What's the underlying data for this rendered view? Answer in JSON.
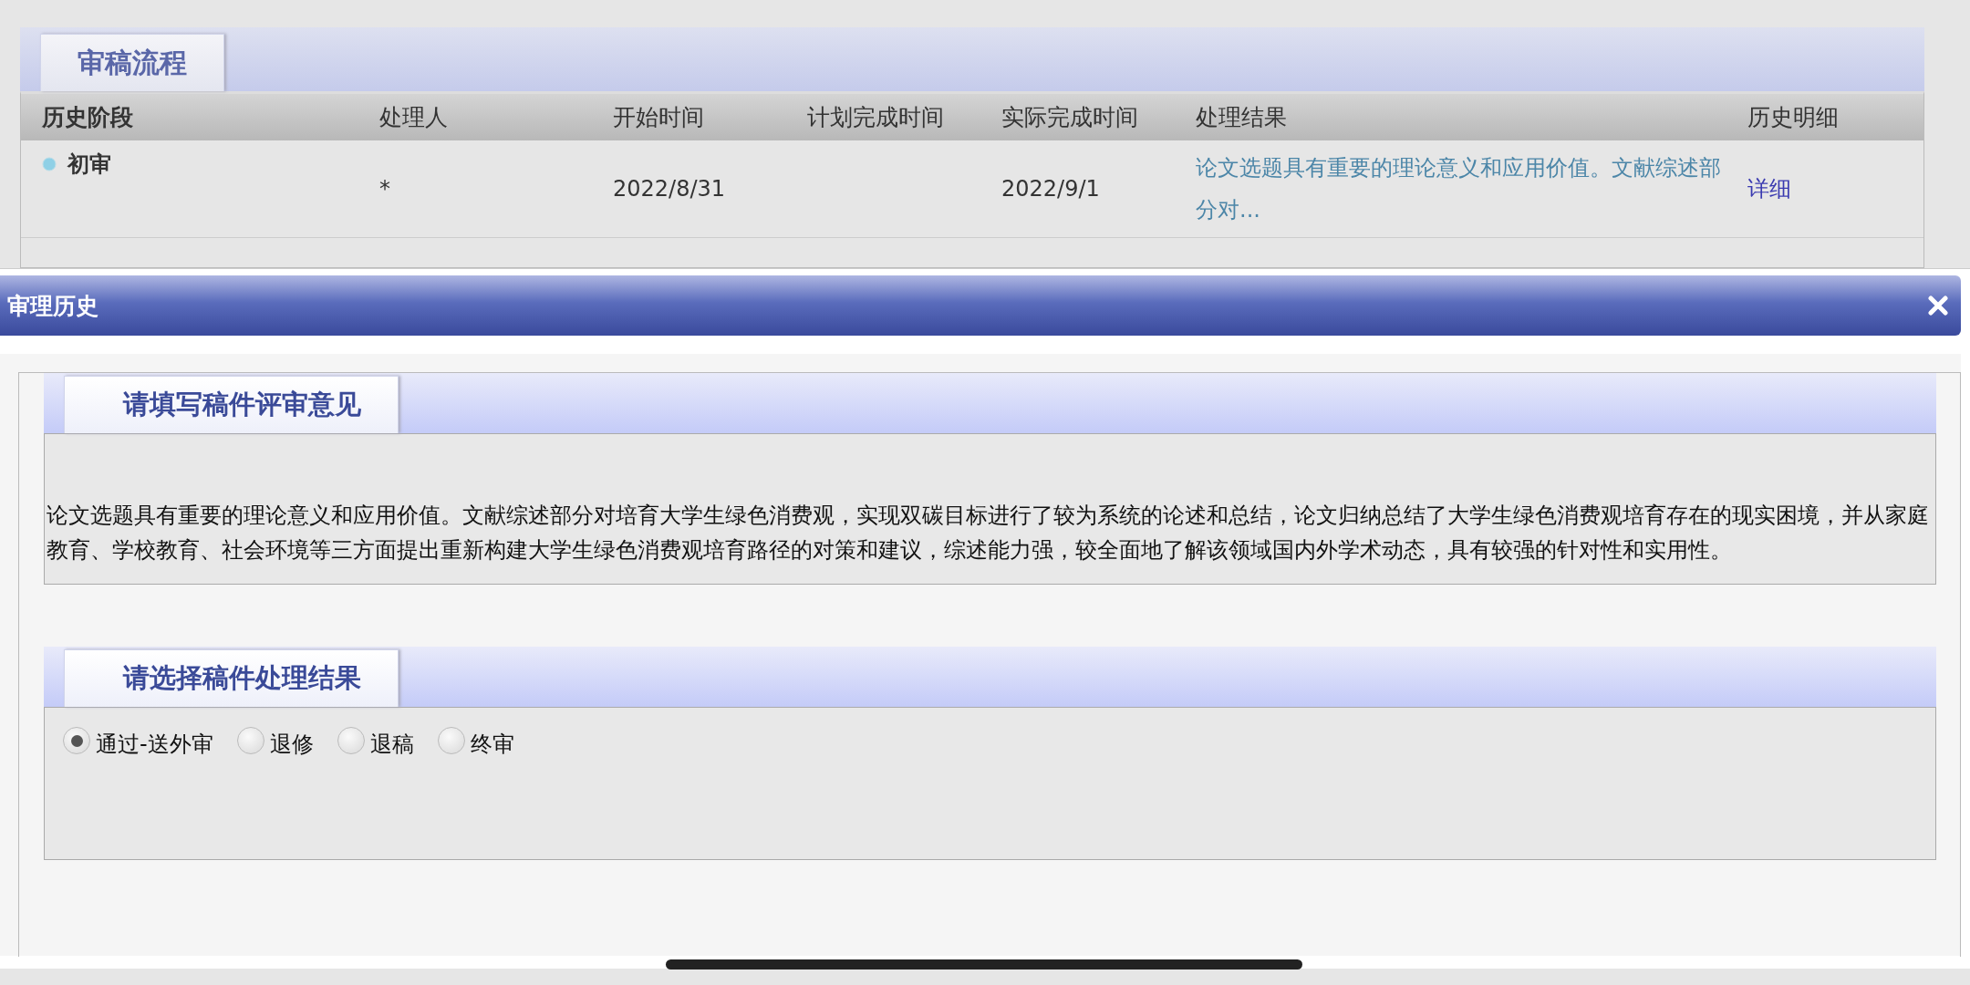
{
  "process_panel": {
    "tab": "审稿流程",
    "columns": [
      "历史阶段",
      "处理人",
      "开始时间",
      "计划完成时间",
      "实际完成时间",
      "处理结果",
      "历史明细"
    ],
    "rows": [
      {
        "stage": "初审",
        "handler": "*",
        "start": "2022/8/31",
        "actual_end": "2022/9/1",
        "result": "论文选题具有重要的理论意义和应用价值。文献综述部分对...",
        "detail_link": "详细"
      }
    ]
  },
  "dialog": {
    "title": "审理历史",
    "sections": [
      {
        "kind": "comment",
        "title": "请填写稿件评审意见",
        "text": "论文选题具有重要的理论意义和应用价值。文献综述部分对培育大学生绿色消费观，实现双碳目标进行了较为系统的论述和总结，论文归纳总结了大学生绿色消费观培育存在的现实困境，并从家庭教育、学校教育、社会环境等三方面提出重新构建大学生绿色消费观培育路径的对策和建议，综述能力强，较全面地了解该领域国内外学术动态，具有较强的针对性和实用性。"
      },
      {
        "kind": "options",
        "title": "请选择稿件处理结果",
        "options": [
          {
            "label": "通过-送外审",
            "selected": true
          },
          {
            "label": "退修",
            "selected": false
          },
          {
            "label": "退稿",
            "selected": false
          },
          {
            "label": "终审",
            "selected": false
          }
        ]
      }
    ]
  }
}
